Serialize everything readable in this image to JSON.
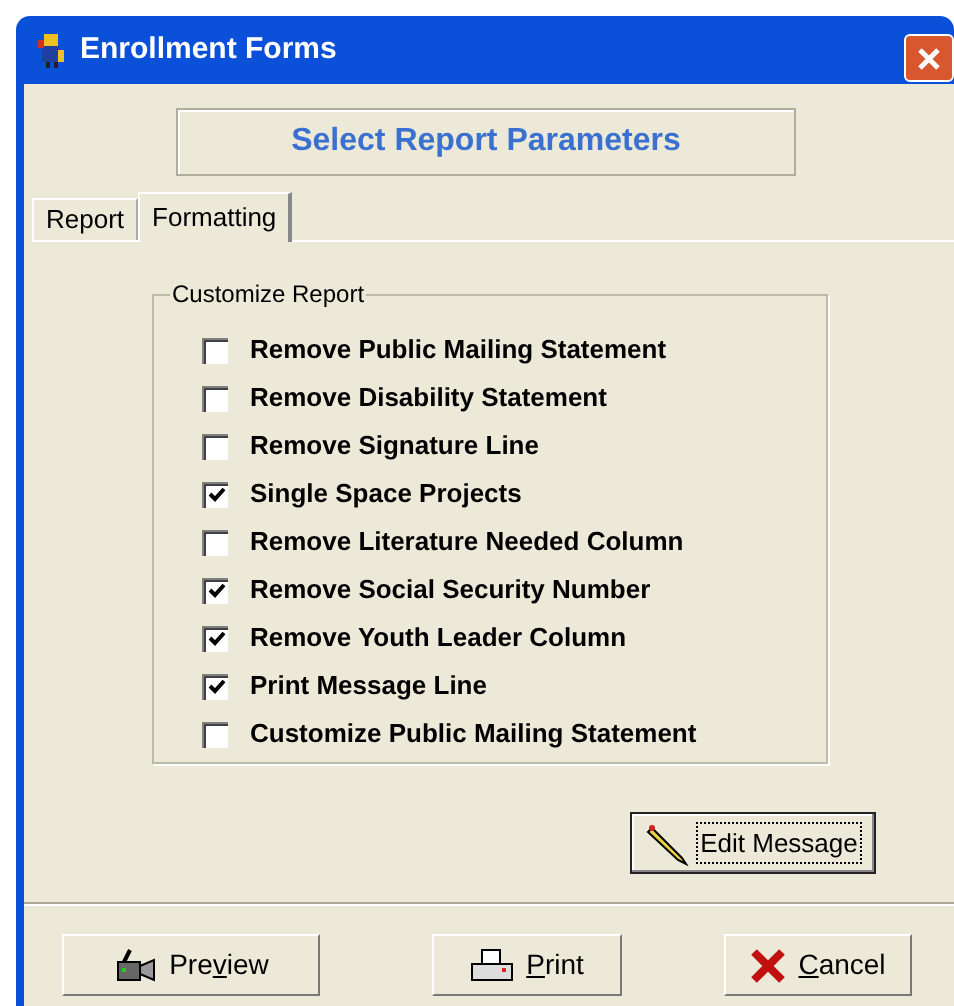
{
  "window": {
    "title": "Enrollment Forms"
  },
  "header": "Select Report Parameters",
  "tabs": [
    {
      "label": "Report",
      "selected": false
    },
    {
      "label": "Formatting",
      "selected": true
    }
  ],
  "group": {
    "title": "Customize Report",
    "options": [
      {
        "label": "Remove Public Mailing Statement",
        "checked": false
      },
      {
        "label": "Remove Disability Statement",
        "checked": false
      },
      {
        "label": "Remove Signature Line",
        "checked": false
      },
      {
        "label": "Single Space Projects",
        "checked": true
      },
      {
        "label": "Remove Literature Needed Column",
        "checked": false
      },
      {
        "label": "Remove Social Security Number",
        "checked": true
      },
      {
        "label": "Remove Youth Leader Column",
        "checked": true
      },
      {
        "label": "Print Message Line",
        "checked": true
      },
      {
        "label": "Customize Public Mailing Statement",
        "checked": false
      }
    ]
  },
  "edit_button": {
    "label": "Edit Message",
    "focused": true
  },
  "buttons": [
    {
      "kind": "preview",
      "before": "Pre",
      "mnemonic": "v",
      "after": "iew"
    },
    {
      "kind": "print",
      "mnemonic": "P",
      "after": "rint"
    },
    {
      "kind": "cancel",
      "mnemonic": "C",
      "after": "ancel"
    }
  ]
}
